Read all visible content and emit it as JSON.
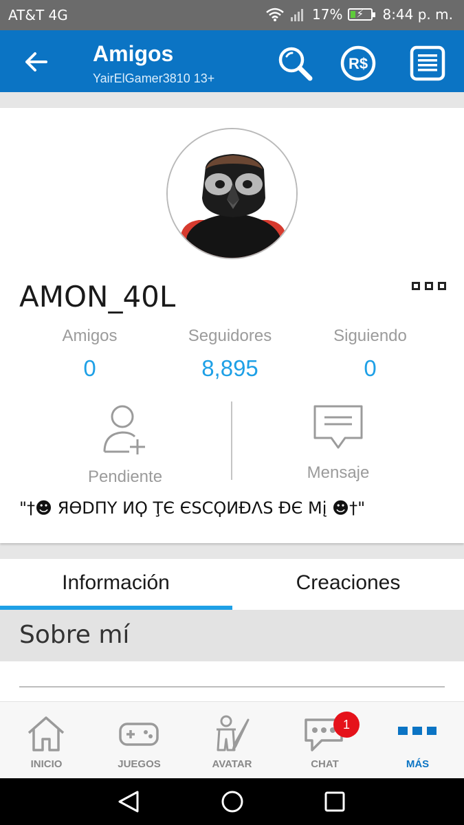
{
  "status_bar": {
    "carrier": "AT&T 4G",
    "battery": "17%",
    "time": "8:44 p. m."
  },
  "app_bar": {
    "title": "Amigos",
    "subtitle": "YairElGamer3810 13+"
  },
  "profile": {
    "username": "AMON_40L",
    "stats": [
      {
        "label": "Amigos",
        "value": "0"
      },
      {
        "label": "Seguidores",
        "value": "8,895"
      },
      {
        "label": "Siguiendo",
        "value": "0"
      }
    ],
    "actions": {
      "pending_label": "Pendiente",
      "message_label": "Mensaje"
    },
    "status_text": "\"†☻ ЯӨDПY ИϘ ŢЄ ЄSCϘИÐΛS ÐЄ Mį ☻†\""
  },
  "tabs": {
    "info": "Información",
    "creations": "Creaciones"
  },
  "about": {
    "title": "Sobre mí"
  },
  "bottom_nav": {
    "items": [
      {
        "label": "INICIO"
      },
      {
        "label": "JUEGOS"
      },
      {
        "label": "AVATAR"
      },
      {
        "label": "CHAT"
      },
      {
        "label": "MÁS"
      }
    ],
    "chat_badge": "1"
  },
  "colors": {
    "accent": "#0b74c4",
    "link": "#1ea0e6",
    "badge": "#e5121a"
  }
}
